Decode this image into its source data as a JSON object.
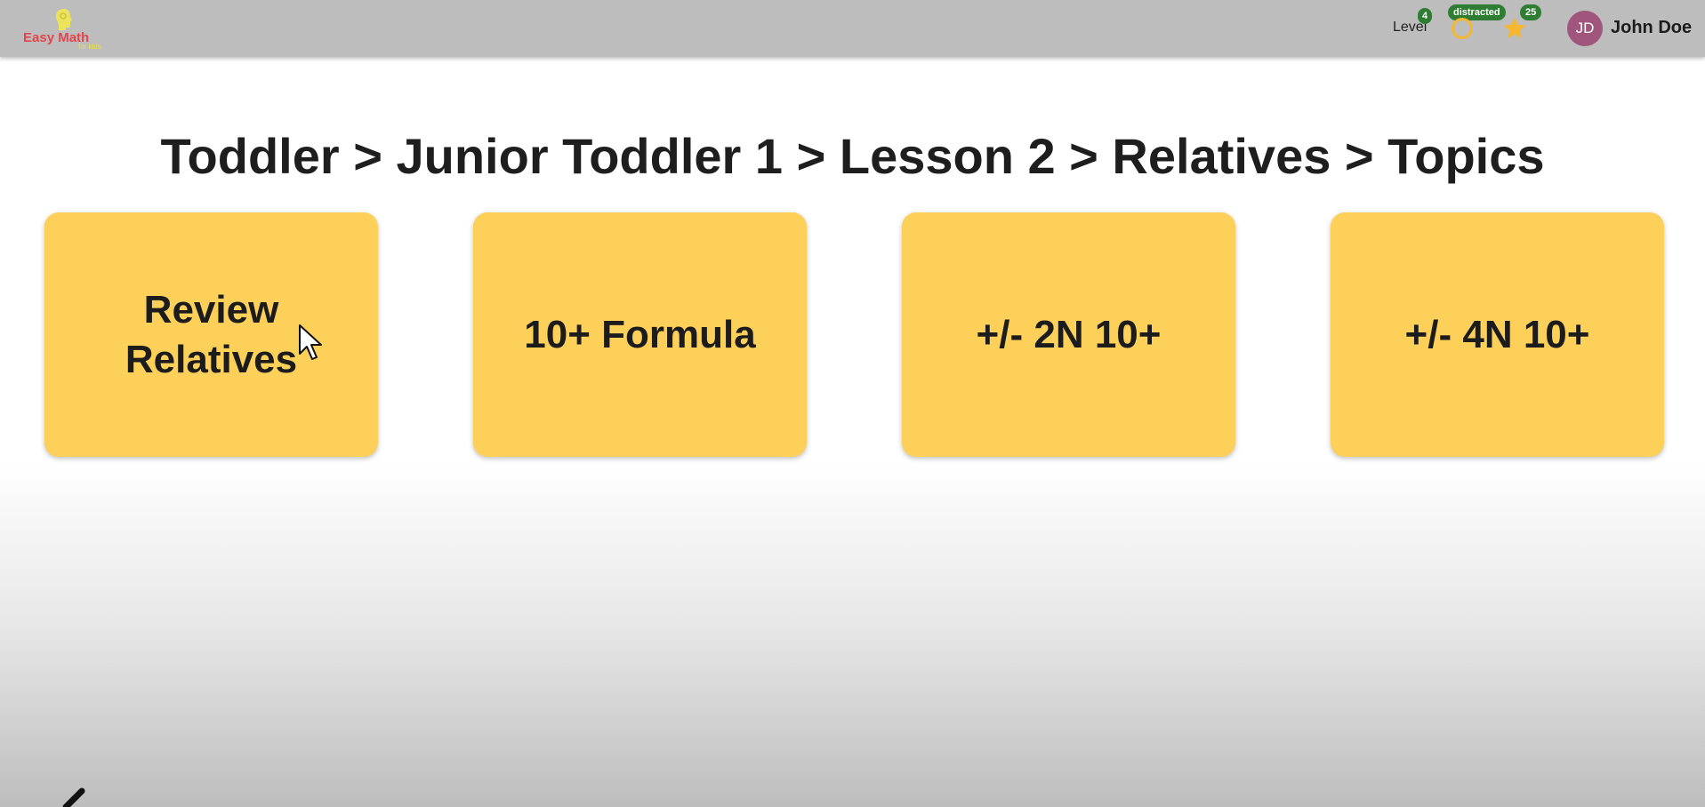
{
  "header": {
    "logo_text": "Easy Math",
    "logo_sub": "for kids",
    "level_label": "Level",
    "level_value": "4",
    "status_badge": "distracted",
    "star_count": "25",
    "avatar_initials": "JD",
    "username": "John Doe"
  },
  "main": {
    "title": "Toddler > Junior Toddler 1 > Lesson 2 > Relatives > Topics",
    "cards": [
      {
        "label": "Review Relatives"
      },
      {
        "label": "10+ Formula"
      },
      {
        "label": "+/- 2N 10+"
      },
      {
        "label": "+/- 4N 10+"
      }
    ]
  },
  "colors": {
    "header_bg": "#bdbdbd",
    "card_bg": "#fdd05a",
    "badge_green": "#2e7d32",
    "avatar_bg": "#a0557c",
    "star": "#f5b731",
    "ring": "#f5b731"
  }
}
